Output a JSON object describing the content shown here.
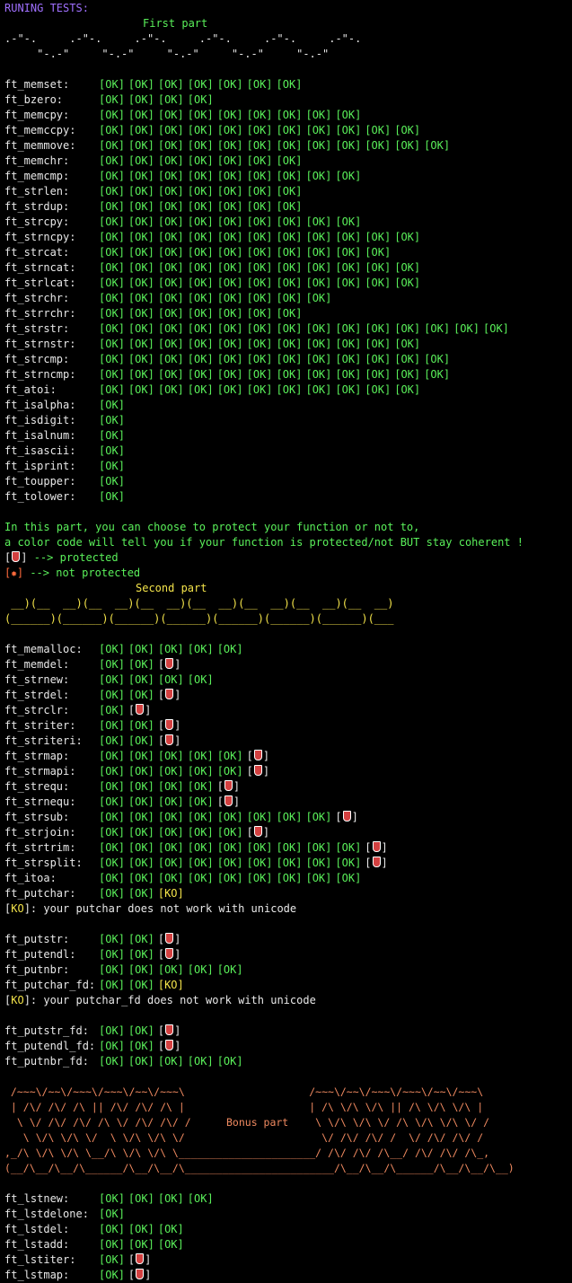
{
  "header": {
    "title": "RUNING TESTS:"
  },
  "colors": {
    "title": "#a070ff",
    "ok": "#5af05a",
    "ko": "#f3e34a",
    "part": "#f3e34a",
    "bonus_art": "#f08a60",
    "background": "#000000"
  },
  "part1": {
    "title": "First part",
    "art": [
      ".-\"-.     .-\"-.     .-\"-.     .-\"-.     .-\"-.     .-\"-.",
      "     \"-.-\"     \"-.-\"     \"-.-\"     \"-.-\"     \"-.-\""
    ],
    "tests": [
      {
        "name": "ft_memset:",
        "results": [
          "OK",
          "OK",
          "OK",
          "OK",
          "OK",
          "OK",
          "OK"
        ]
      },
      {
        "name": "ft_bzero:",
        "results": [
          "OK",
          "OK",
          "OK",
          "OK"
        ]
      },
      {
        "name": "ft_memcpy:",
        "results": [
          "OK",
          "OK",
          "OK",
          "OK",
          "OK",
          "OK",
          "OK",
          "OK",
          "OK"
        ]
      },
      {
        "name": "ft_memccpy:",
        "results": [
          "OK",
          "OK",
          "OK",
          "OK",
          "OK",
          "OK",
          "OK",
          "OK",
          "OK",
          "OK",
          "OK"
        ]
      },
      {
        "name": "ft_memmove:",
        "results": [
          "OK",
          "OK",
          "OK",
          "OK",
          "OK",
          "OK",
          "OK",
          "OK",
          "OK",
          "OK",
          "OK",
          "OK"
        ]
      },
      {
        "name": "ft_memchr:",
        "results": [
          "OK",
          "OK",
          "OK",
          "OK",
          "OK",
          "OK",
          "OK"
        ]
      },
      {
        "name": "ft_memcmp:",
        "results": [
          "OK",
          "OK",
          "OK",
          "OK",
          "OK",
          "OK",
          "OK",
          "OK",
          "OK"
        ]
      },
      {
        "name": "ft_strlen:",
        "results": [
          "OK",
          "OK",
          "OK",
          "OK",
          "OK",
          "OK",
          "OK"
        ]
      },
      {
        "name": "ft_strdup:",
        "results": [
          "OK",
          "OK",
          "OK",
          "OK",
          "OK",
          "OK",
          "OK"
        ]
      },
      {
        "name": "ft_strcpy:",
        "results": [
          "OK",
          "OK",
          "OK",
          "OK",
          "OK",
          "OK",
          "OK",
          "OK",
          "OK"
        ]
      },
      {
        "name": "ft_strncpy:",
        "results": [
          "OK",
          "OK",
          "OK",
          "OK",
          "OK",
          "OK",
          "OK",
          "OK",
          "OK",
          "OK",
          "OK"
        ]
      },
      {
        "name": "ft_strcat:",
        "results": [
          "OK",
          "OK",
          "OK",
          "OK",
          "OK",
          "OK",
          "OK",
          "OK",
          "OK",
          "OK"
        ]
      },
      {
        "name": "ft_strncat:",
        "results": [
          "OK",
          "OK",
          "OK",
          "OK",
          "OK",
          "OK",
          "OK",
          "OK",
          "OK",
          "OK",
          "OK"
        ]
      },
      {
        "name": "ft_strlcat:",
        "results": [
          "OK",
          "OK",
          "OK",
          "OK",
          "OK",
          "OK",
          "OK",
          "OK",
          "OK",
          "OK",
          "OK"
        ]
      },
      {
        "name": "ft_strchr:",
        "results": [
          "OK",
          "OK",
          "OK",
          "OK",
          "OK",
          "OK",
          "OK",
          "OK"
        ]
      },
      {
        "name": "ft_strrchr:",
        "results": [
          "OK",
          "OK",
          "OK",
          "OK",
          "OK",
          "OK",
          "OK"
        ]
      },
      {
        "name": "ft_strstr:",
        "results": [
          "OK",
          "OK",
          "OK",
          "OK",
          "OK",
          "OK",
          "OK",
          "OK",
          "OK",
          "OK",
          "OK",
          "OK",
          "OK",
          "OK"
        ]
      },
      {
        "name": "ft_strnstr:",
        "results": [
          "OK",
          "OK",
          "OK",
          "OK",
          "OK",
          "OK",
          "OK",
          "OK",
          "OK",
          "OK",
          "OK"
        ]
      },
      {
        "name": "ft_strcmp:",
        "results": [
          "OK",
          "OK",
          "OK",
          "OK",
          "OK",
          "OK",
          "OK",
          "OK",
          "OK",
          "OK",
          "OK",
          "OK"
        ]
      },
      {
        "name": "ft_strncmp:",
        "results": [
          "OK",
          "OK",
          "OK",
          "OK",
          "OK",
          "OK",
          "OK",
          "OK",
          "OK",
          "OK",
          "OK",
          "OK"
        ]
      },
      {
        "name": "ft_atoi:",
        "results": [
          "OK",
          "OK",
          "OK",
          "OK",
          "OK",
          "OK",
          "OK",
          "OK",
          "OK",
          "OK",
          "OK"
        ]
      },
      {
        "name": "ft_isalpha:",
        "results": [
          "OK"
        ]
      },
      {
        "name": "ft_isdigit:",
        "results": [
          "OK"
        ]
      },
      {
        "name": "ft_isalnum:",
        "results": [
          "OK"
        ]
      },
      {
        "name": "ft_isascii:",
        "results": [
          "OK"
        ]
      },
      {
        "name": "ft_isprint:",
        "results": [
          "OK"
        ]
      },
      {
        "name": "ft_toupper:",
        "results": [
          "OK"
        ]
      },
      {
        "name": "ft_tolower:",
        "results": [
          "OK"
        ]
      }
    ]
  },
  "info": {
    "line1": "In this part, you can choose to protect your function or not to,",
    "line2": "a color code will tell you if your function is protected/not BUT stay coherent !",
    "legend_protected": " --> protected",
    "legend_not_protected": " --> not protected"
  },
  "part2": {
    "title": "Second part",
    "art": [
      " __)(__  __)(__  __)(__  __)(__  __)(__  __)(__  __)(__  __)",
      "(______)(______)(______)(______)(______)(______)(______)(___"
    ],
    "blocks": [
      {
        "tests": [
          {
            "name": "ft_memalloc:",
            "results": [
              "OK",
              "OK",
              "OK",
              "OK",
              "OK"
            ]
          },
          {
            "name": "ft_memdel:",
            "results": [
              "OK",
              "OK",
              "P"
            ]
          },
          {
            "name": "ft_strnew:",
            "results": [
              "OK",
              "OK",
              "OK",
              "OK"
            ]
          },
          {
            "name": "ft_strdel:",
            "results": [
              "OK",
              "OK",
              "P"
            ]
          },
          {
            "name": "ft_strclr:",
            "results": [
              "OK",
              "P"
            ]
          },
          {
            "name": "ft_striter:",
            "results": [
              "OK",
              "OK",
              "P"
            ]
          },
          {
            "name": "ft_striteri:",
            "results": [
              "OK",
              "OK",
              "P"
            ]
          },
          {
            "name": "ft_strmap:",
            "results": [
              "OK",
              "OK",
              "OK",
              "OK",
              "OK",
              "P"
            ]
          },
          {
            "name": "ft_strmapi:",
            "results": [
              "OK",
              "OK",
              "OK",
              "OK",
              "OK",
              "P"
            ]
          },
          {
            "name": "ft_strequ:",
            "results": [
              "OK",
              "OK",
              "OK",
              "OK",
              "P"
            ]
          },
          {
            "name": "ft_strnequ:",
            "results": [
              "OK",
              "OK",
              "OK",
              "OK",
              "P"
            ]
          },
          {
            "name": "ft_strsub:",
            "results": [
              "OK",
              "OK",
              "OK",
              "OK",
              "OK",
              "OK",
              "OK",
              "OK",
              "P"
            ]
          },
          {
            "name": "ft_strjoin:",
            "results": [
              "OK",
              "OK",
              "OK",
              "OK",
              "OK",
              "P"
            ]
          },
          {
            "name": "ft_strtrim:",
            "results": [
              "OK",
              "OK",
              "OK",
              "OK",
              "OK",
              "OK",
              "OK",
              "OK",
              "OK",
              "P"
            ]
          },
          {
            "name": "ft_strsplit:",
            "results": [
              "OK",
              "OK",
              "OK",
              "OK",
              "OK",
              "OK",
              "OK",
              "OK",
              "OK",
              "P"
            ]
          },
          {
            "name": "ft_itoa:",
            "results": [
              "OK",
              "OK",
              "OK",
              "OK",
              "OK",
              "OK",
              "OK",
              "OK",
              "OK"
            ]
          },
          {
            "name": "ft_putchar:",
            "results": [
              "OK",
              "OK",
              "KO"
            ]
          }
        ],
        "note": ": your putchar does not work with unicode"
      },
      {
        "tests": [
          {
            "name": "ft_putstr:",
            "results": [
              "OK",
              "OK",
              "P"
            ]
          },
          {
            "name": "ft_putendl:",
            "results": [
              "OK",
              "OK",
              "P"
            ]
          },
          {
            "name": "ft_putnbr:",
            "results": [
              "OK",
              "OK",
              "OK",
              "OK",
              "OK"
            ]
          },
          {
            "name": "ft_putchar_fd:",
            "results": [
              "OK",
              "OK",
              "KO"
            ]
          }
        ],
        "note": ": your putchar_fd does not work with unicode"
      },
      {
        "tests": [
          {
            "name": "ft_putstr_fd:",
            "results": [
              "OK",
              "OK",
              "P"
            ]
          },
          {
            "name": "ft_putendl_fd:",
            "results": [
              "OK",
              "OK",
              "P"
            ]
          },
          {
            "name": "ft_putnbr_fd:",
            "results": [
              "OK",
              "OK",
              "OK",
              "OK",
              "OK"
            ]
          }
        ],
        "note": ""
      }
    ]
  },
  "bonus": {
    "title": "Bonus part",
    "art": [
      " /~~~\\/~~\\/~~~\\/~~~\\/~~\\/~~~\\                    /~~~\\/~~\\/~~~\\/~~~\\/~~\\/~~~\\",
      " | /\\/ /\\/ /\\ || /\\/ /\\/ /\\ |                    | /\\ \\/\\ \\/\\ || /\\ \\/\\ \\/\\ |",
      "  \\ \\/ /\\/ /\\/ /\\ \\/ /\\/ /\\/ /                    \\ \\/\\ \\/\\ \\/ /\\ \\/\\ \\/\\ \\/ /",
      "   \\ \\/\\ \\/\\ \\/  \\ \\/\\ \\/\\ \\/                      \\/ /\\/ /\\/ /  \\/ /\\/ /\\/ /",
      ",_/\\ \\/\\ \\/\\ \\__/\\ \\/\\ \\/\\ \\______________________/ /\\/ /\\/ /\\__/ /\\/ /\\/ /\\_,",
      "(__/\\__/\\__/\\______/\\__/\\__/\\________________________/\\__/\\__/\\______/\\__/\\__/\\__)"
    ],
    "tests": [
      {
        "name": "ft_lstnew:",
        "results": [
          "OK",
          "OK",
          "OK",
          "OK"
        ]
      },
      {
        "name": "ft_lstdelone:",
        "results": [
          "OK"
        ]
      },
      {
        "name": "ft_lstdel:",
        "results": [
          "OK",
          "OK",
          "OK"
        ]
      },
      {
        "name": "ft_lstadd:",
        "results": [
          "OK",
          "OK",
          "OK"
        ]
      },
      {
        "name": "ft_lstiter:",
        "results": [
          "OK",
          "P"
        ]
      },
      {
        "name": "ft_lstmap:",
        "results": [
          "OK",
          "P"
        ]
      }
    ]
  }
}
